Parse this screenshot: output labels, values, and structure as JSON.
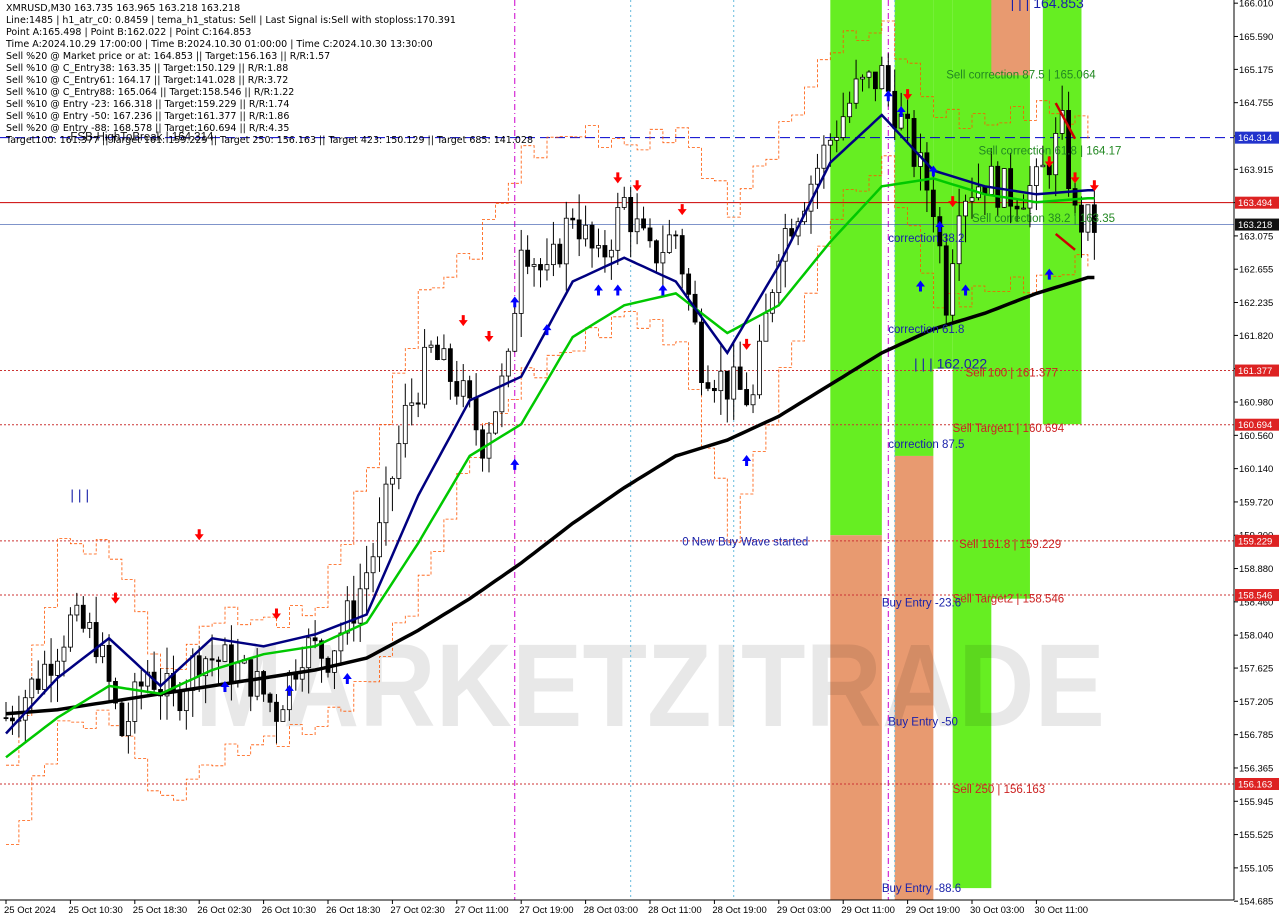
{
  "info_lines": [
    "XMRUSD,M30  163.735 163.965 163.218 163.218",
    "Line:1485 | h1_atr_c0: 0.8459 | tema_h1_status: Sell | Last Signal is:Sell with stoploss:170.391",
    "Point A:165.498 | Point B:162.022 | Point C:164.853",
    "Time A:2024.10.29 17:00:00 | Time B:2024.10.30 01:00:00 | Time C:2024.10.30 13:30:00",
    "Sell %20 @ Market price or at: 164.853 || Target:156.163 || R/R:1.57",
    "Sell %10 @ C_Entry38: 163.35 || Target:150.129 || R/R:1.88",
    "Sell %10 @ C_Entry61: 164.17 || Target:141.028 || R/R:3.72",
    "Sell %10 @ C_Entry88: 165.064 || Target:158.546 || R/R:1.22",
    "Sell %10 @ Entry -23: 166.318 || Target:159.229 || R/R:1.74",
    "Sell %10 @ Entry -50: 167.236 || Target:161.377 || R/R:1.86",
    "Sell %20 @ Entry -88: 168.578 || Target:160.694 || R/R:4.35",
    "Target100: 161.377 || Target 161: 159.229 || Target 250: 156.163 || Target 423: 150.129 || Target 685: 141.028"
  ],
  "watermark": "MARKETZITRADE",
  "colors": {
    "background": "#ffffff",
    "candle": "#000000",
    "ma_slow": "#000000",
    "ma_mid": "#00c800",
    "ma_fast": "#000080",
    "envelope": "#ff5500",
    "sell_arrow": "#ff0000",
    "buy_arrow": "#0000ff",
    "green_zone": "#66ee22",
    "orange_zone": "#e89a70",
    "red_line": "#cc0000",
    "blue_dash": "#0000cc",
    "label_red_bg": "#dd2222",
    "label_blue_bg": "#2233cc",
    "label_dark_bg": "#111111",
    "level_label_red": "#cc2222",
    "level_label_blue": "#2233aa"
  },
  "chart_data": {
    "type": "candlestick",
    "symbol": "XMRUSD",
    "timeframe": "M30",
    "ylim": [
      154.7,
      166.05
    ],
    "y_ticks": [
      "166.010",
      "165.590",
      "165.175",
      "164.755",
      "164.335",
      "163.915",
      "163.495",
      "163.075",
      "162.655",
      "162.235",
      "161.820",
      "161.400",
      "160.980",
      "160.560",
      "160.140",
      "159.720",
      "159.300",
      "158.880",
      "158.460",
      "158.040",
      "157.625",
      "157.205",
      "156.785",
      "156.365",
      "155.945",
      "155.525",
      "155.105",
      "154.685"
    ],
    "x_tick_labels": [
      "25 Oct 2024",
      "25 Oct 10:30",
      "25 Oct 18:30",
      "26 Oct 02:30",
      "26 Oct 10:30",
      "26 Oct 18:30",
      "27 Oct 02:30",
      "27 Oct 11:00",
      "27 Oct 19:00",
      "28 Oct 03:00",
      "28 Oct 11:00",
      "28 Oct 19:00",
      "29 Oct 03:00",
      "29 Oct 11:00",
      "29 Oct 19:00",
      "30 Oct 03:00",
      "30 Oct 11:00"
    ],
    "price_labels": [
      {
        "text": "164.314",
        "value": 164.314,
        "style": "blue"
      },
      {
        "text": "163.494",
        "value": 163.494,
        "style": "red"
      },
      {
        "text": "163.218",
        "value": 163.218,
        "style": "dark"
      },
      {
        "text": "161.377",
        "value": 161.377,
        "style": "red"
      },
      {
        "text": "160.694",
        "value": 160.694,
        "style": "red"
      },
      {
        "text": "159.229",
        "value": 159.229,
        "style": "red"
      },
      {
        "text": "158.546",
        "value": 158.546,
        "style": "red"
      },
      {
        "text": "156.163",
        "value": 156.163,
        "style": "red"
      }
    ],
    "horizontal_levels": [
      {
        "value": 164.314,
        "style": "blue-dash"
      },
      {
        "value": 163.494,
        "style": "red-solid"
      },
      {
        "value": 163.218,
        "style": "blue-thin"
      },
      {
        "value": 161.377,
        "style": "red-dot"
      },
      {
        "value": 160.694,
        "style": "red-dot"
      },
      {
        "value": 159.229,
        "style": "red-dot"
      },
      {
        "value": 158.546,
        "style": "red-dot"
      },
      {
        "value": 156.163,
        "style": "red-dot"
      }
    ],
    "annotations": [
      {
        "text": "Sell correction 87.5 | 165.064",
        "color": "green",
        "bar": 146,
        "value": 165.06
      },
      {
        "text": "Sell correction 61.8 | 164.17",
        "color": "green",
        "bar": 151,
        "value": 164.1
      },
      {
        "text": "Sell correction 38.2 | 163.35",
        "color": "green",
        "bar": 150,
        "value": 163.25
      },
      {
        "text": "correction 38.2",
        "color": "blue",
        "bar": 137,
        "value": 163.0
      },
      {
        "text": "correction 61.8",
        "color": "blue",
        "bar": 137,
        "value": 161.85
      },
      {
        "text": "correction 87.5",
        "color": "blue",
        "bar": 137,
        "value": 160.4
      },
      {
        "text": "| | | 162.022",
        "color": "blue",
        "bar": 141,
        "value": 161.4
      },
      {
        "text": "Sell 100 | 161.377",
        "color": "red",
        "bar": 149,
        "value": 161.3
      },
      {
        "text": "Sell Target1 | 160.694",
        "color": "red",
        "bar": 147,
        "value": 160.6
      },
      {
        "text": "Sell 161.8 | 159.229",
        "color": "red",
        "bar": 148,
        "value": 159.14
      },
      {
        "text": "Sell Target2 | 158.546",
        "color": "red",
        "bar": 147,
        "value": 158.45
      },
      {
        "text": "Sell  250 | 156.163",
        "color": "red",
        "bar": 147,
        "value": 156.05
      },
      {
        "text": "Buy Entry -23.6",
        "color": "blue",
        "bar": 136,
        "value": 158.4
      },
      {
        "text": "Buy Entry -50",
        "color": "blue",
        "bar": 137,
        "value": 156.9
      },
      {
        "text": "Buy Entry -88.6",
        "color": "blue",
        "bar": 136,
        "value": 154.8
      },
      {
        "text": "0 New Buy Wave started",
        "color": "blue",
        "bar": 105,
        "value": 159.17
      },
      {
        "text": "| | | 164.853",
        "color": "blue",
        "bar": 156,
        "value": 165.95
      },
      {
        "text": "| | |",
        "color": "blue",
        "bar": 10,
        "value": 159.75
      },
      {
        "text": "FSB-HighToBreak | 164.314",
        "color": "black",
        "bar": 10,
        "value": 164.28
      }
    ],
    "zones": [
      {
        "bar_start": 128,
        "bar_end": 136,
        "top": 166.05,
        "bottom": 159.3,
        "color": "green"
      },
      {
        "bar_start": 128,
        "bar_end": 136,
        "top": 159.3,
        "bottom": 154.7,
        "color": "orange"
      },
      {
        "bar_start": 138,
        "bar_end": 144,
        "top": 166.05,
        "bottom": 160.3,
        "color": "green"
      },
      {
        "bar_start": 138,
        "bar_end": 144,
        "top": 160.3,
        "bottom": 154.7,
        "color": "orange"
      },
      {
        "bar_start": 144,
        "bar_end": 147,
        "top": 166.05,
        "bottom": 161.4,
        "color": "green"
      },
      {
        "bar_start": 147,
        "bar_end": 153,
        "top": 166.05,
        "bottom": 154.85,
        "color": "green"
      },
      {
        "bar_start": 151,
        "bar_end": 159,
        "top": 166.05,
        "bottom": 158.5,
        "color": "green"
      },
      {
        "bar_start": 153,
        "bar_end": 159,
        "top": 166.05,
        "bottom": 165.1,
        "color": "orange"
      },
      {
        "bar_start": 161,
        "bar_end": 167,
        "top": 166.05,
        "bottom": 160.7,
        "color": "green"
      }
    ],
    "vertical_lines": [
      {
        "bar": 79,
        "color": "magenta",
        "style": "dash-dot"
      },
      {
        "bar": 97,
        "color": "cyan",
        "style": "dot"
      },
      {
        "bar": 113,
        "color": "cyan",
        "style": "dot"
      },
      {
        "bar": 137,
        "color": "magenta",
        "style": "dash-dot"
      },
      {
        "bar": 138,
        "color": "cyan",
        "style": "dot"
      }
    ],
    "ma_slow": [
      [
        0,
        157.05
      ],
      [
        8,
        157.1
      ],
      [
        16,
        157.2
      ],
      [
        24,
        157.3
      ],
      [
        32,
        157.4
      ],
      [
        40,
        157.5
      ],
      [
        48,
        157.6
      ],
      [
        56,
        157.75
      ],
      [
        64,
        158.1
      ],
      [
        72,
        158.5
      ],
      [
        80,
        158.95
      ],
      [
        88,
        159.45
      ],
      [
        96,
        159.9
      ],
      [
        104,
        160.3
      ],
      [
        112,
        160.5
      ],
      [
        120,
        160.8
      ],
      [
        128,
        161.2
      ],
      [
        136,
        161.6
      ],
      [
        144,
        161.9
      ],
      [
        152,
        162.1
      ],
      [
        160,
        162.35
      ],
      [
        168,
        162.55
      ]
    ],
    "ma_mid": [
      [
        0,
        156.5
      ],
      [
        8,
        157.0
      ],
      [
        16,
        157.4
      ],
      [
        24,
        157.3
      ],
      [
        32,
        157.6
      ],
      [
        40,
        157.8
      ],
      [
        48,
        157.9
      ],
      [
        56,
        158.2
      ],
      [
        64,
        159.2
      ],
      [
        72,
        160.3
      ],
      [
        80,
        160.7
      ],
      [
        88,
        161.8
      ],
      [
        96,
        162.2
      ],
      [
        104,
        162.35
      ],
      [
        112,
        161.85
      ],
      [
        120,
        162.2
      ],
      [
        128,
        163.0
      ],
      [
        136,
        163.7
      ],
      [
        144,
        163.8
      ],
      [
        152,
        163.6
      ],
      [
        160,
        163.5
      ],
      [
        168,
        163.55
      ]
    ],
    "ma_fast": [
      [
        0,
        156.8
      ],
      [
        8,
        157.5
      ],
      [
        16,
        158.0
      ],
      [
        24,
        157.4
      ],
      [
        32,
        158.0
      ],
      [
        40,
        157.9
      ],
      [
        48,
        158.05
      ],
      [
        56,
        158.3
      ],
      [
        64,
        159.8
      ],
      [
        72,
        161.0
      ],
      [
        80,
        161.3
      ],
      [
        88,
        162.5
      ],
      [
        96,
        162.8
      ],
      [
        104,
        162.5
      ],
      [
        112,
        161.6
      ],
      [
        120,
        162.7
      ],
      [
        128,
        164.0
      ],
      [
        136,
        164.6
      ],
      [
        144,
        163.9
      ],
      [
        152,
        163.7
      ],
      [
        160,
        163.6
      ],
      [
        168,
        163.65
      ]
    ],
    "price_anchors": [
      [
        0,
        157.0
      ],
      [
        5,
        157.5
      ],
      [
        10,
        158.2
      ],
      [
        14,
        158.0
      ],
      [
        18,
        156.8
      ],
      [
        22,
        157.6
      ],
      [
        26,
        157.2
      ],
      [
        30,
        157.8
      ],
      [
        34,
        157.7
      ],
      [
        38,
        157.5
      ],
      [
        42,
        157.1
      ],
      [
        46,
        157.9
      ],
      [
        50,
        157.8
      ],
      [
        54,
        158.4
      ],
      [
        58,
        159.3
      ],
      [
        62,
        160.8
      ],
      [
        66,
        161.6
      ],
      [
        70,
        161.2
      ],
      [
        74,
        160.5
      ],
      [
        78,
        161.4
      ],
      [
        80,
        163.1
      ],
      [
        84,
        162.5
      ],
      [
        88,
        163.4
      ],
      [
        92,
        162.7
      ],
      [
        96,
        163.5
      ],
      [
        100,
        162.8
      ],
      [
        104,
        163.1
      ],
      [
        108,
        161.5
      ],
      [
        112,
        161.2
      ],
      [
        116,
        161.0
      ],
      [
        120,
        163.0
      ],
      [
        124,
        163.6
      ],
      [
        128,
        164.3
      ],
      [
        132,
        164.9
      ],
      [
        136,
        165.1
      ],
      [
        140,
        164.3
      ],
      [
        144,
        163.5
      ],
      [
        146,
        162.3
      ],
      [
        148,
        163.6
      ],
      [
        152,
        163.8
      ],
      [
        156,
        163.6
      ],
      [
        160,
        163.7
      ],
      [
        164,
        164.4
      ],
      [
        166,
        163.3
      ],
      [
        168,
        163.22
      ]
    ],
    "envelope_upper": [
      [
        0,
        156.4
      ],
      [
        8,
        159.2
      ],
      [
        16,
        159.1
      ],
      [
        24,
        157.5
      ],
      [
        32,
        158.3
      ],
      [
        40,
        158.2
      ],
      [
        48,
        158.4
      ],
      [
        56,
        160.2
      ],
      [
        64,
        162.3
      ],
      [
        72,
        162.9
      ],
      [
        80,
        164.1
      ],
      [
        88,
        164.4
      ],
      [
        96,
        164.2
      ],
      [
        104,
        164.4
      ],
      [
        112,
        163.4
      ],
      [
        120,
        164.4
      ],
      [
        128,
        165.5
      ],
      [
        136,
        165.7
      ],
      [
        144,
        164.6
      ],
      [
        152,
        164.5
      ],
      [
        160,
        164.7
      ],
      [
        168,
        164.4
      ]
    ],
    "envelope_lower": [
      [
        0,
        155.4
      ],
      [
        8,
        156.9
      ],
      [
        16,
        157.0
      ],
      [
        24,
        155.9
      ],
      [
        32,
        156.5
      ],
      [
        40,
        156.7
      ],
      [
        48,
        156.9
      ],
      [
        56,
        157.5
      ],
      [
        64,
        158.7
      ],
      [
        72,
        160.4
      ],
      [
        80,
        161.3
      ],
      [
        88,
        161.7
      ],
      [
        96,
        162.1
      ],
      [
        104,
        161.7
      ],
      [
        112,
        159.3
      ],
      [
        120,
        161.3
      ],
      [
        128,
        163.4
      ],
      [
        136,
        164.0
      ],
      [
        144,
        162.2
      ],
      [
        152,
        162.4
      ],
      [
        160,
        162.5
      ],
      [
        168,
        162.8
      ]
    ],
    "sell_arrows": [
      [
        17,
        158.45
      ],
      [
        30,
        159.25
      ],
      [
        42,
        158.25
      ],
      [
        71,
        161.95
      ],
      [
        75,
        161.75
      ],
      [
        95,
        163.75
      ],
      [
        98,
        163.65
      ],
      [
        105,
        163.35
      ],
      [
        115,
        161.65
      ],
      [
        140,
        164.8
      ],
      [
        147,
        163.45
      ],
      [
        162,
        163.95
      ],
      [
        166,
        163.75
      ],
      [
        169,
        163.65
      ]
    ],
    "buy_arrows": [
      [
        34,
        157.45
      ],
      [
        44,
        157.4
      ],
      [
        53,
        157.55
      ],
      [
        79,
        162.3
      ],
      [
        84,
        161.95
      ],
      [
        79,
        160.25
      ],
      [
        92,
        162.45
      ],
      [
        95,
        162.45
      ],
      [
        102,
        162.45
      ],
      [
        115,
        160.3
      ],
      [
        137,
        164.9
      ],
      [
        139,
        164.7
      ],
      [
        144,
        163.95
      ],
      [
        145,
        163.25
      ],
      [
        142,
        162.5
      ],
      [
        149,
        162.45
      ],
      [
        162,
        162.65
      ]
    ],
    "red_diagonal": [
      [
        163,
        164.75
      ],
      [
        166,
        164.3
      ],
      [
        163,
        163.1
      ],
      [
        166,
        162.9
      ]
    ]
  }
}
